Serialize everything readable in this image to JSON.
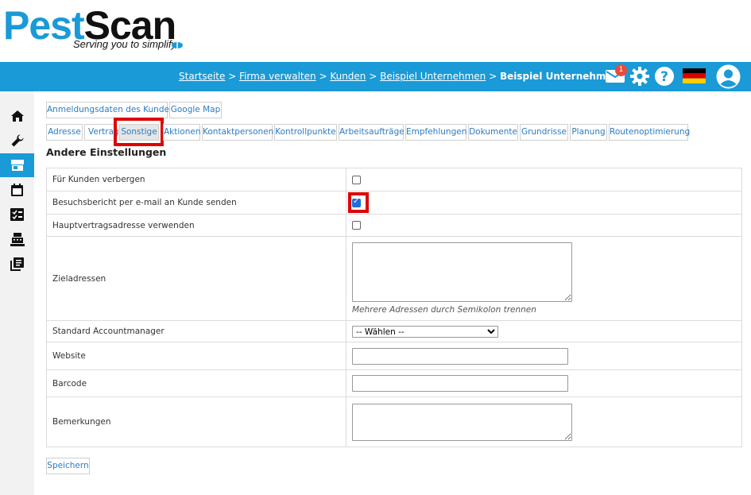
{
  "logo": {
    "part1": "Pest",
    "part2": "Scan",
    "tagline": "Serving you to simplify"
  },
  "breadcrumb": {
    "items": [
      "Startseite",
      "Firma verwalten",
      "Kunden",
      "Beispiel Unternehmen"
    ],
    "current": "Beispiel Unternehmen",
    "separator": " > "
  },
  "topbar": {
    "mail_badge": "1"
  },
  "top_buttons": [
    "Anmeldungsdaten des Kunden",
    "Google Map"
  ],
  "tabs": [
    "Adresse",
    "Vertrag",
    "Sonstige",
    "Aktionen",
    "Kontaktpersonen",
    "Kontrollpunkte",
    "Arbeitsaufträge",
    "Empfehlungen",
    "Dokumente",
    "Grundrisse",
    "Planung",
    "Routenoptimierung"
  ],
  "active_tab": "Sonstige",
  "section_title": "Andere Einstellungen",
  "form": {
    "hide_customer": {
      "label": "Für Kunden verbergen",
      "checked": false
    },
    "email_report": {
      "label": "Besuchsbericht per e-mail an Kunde senden",
      "checked": true
    },
    "main_address": {
      "label": "Hauptvertragsadresse verwenden",
      "checked": false
    },
    "target_addresses": {
      "label": "Zieladressen",
      "value": "",
      "hint": "Mehrere Adressen durch Semikolon trennen"
    },
    "account_manager": {
      "label": "Standard Accountmanager",
      "selected": "-- Wählen --"
    },
    "website": {
      "label": "Website",
      "value": ""
    },
    "barcode": {
      "label": "Barcode",
      "value": ""
    },
    "remarks": {
      "label": "Bemerkungen",
      "value": ""
    }
  },
  "save_label": "Speichern",
  "colors": {
    "brand_blue": "#1a9ad6",
    "highlight": "#e00000",
    "link": "#2a7cc4"
  }
}
